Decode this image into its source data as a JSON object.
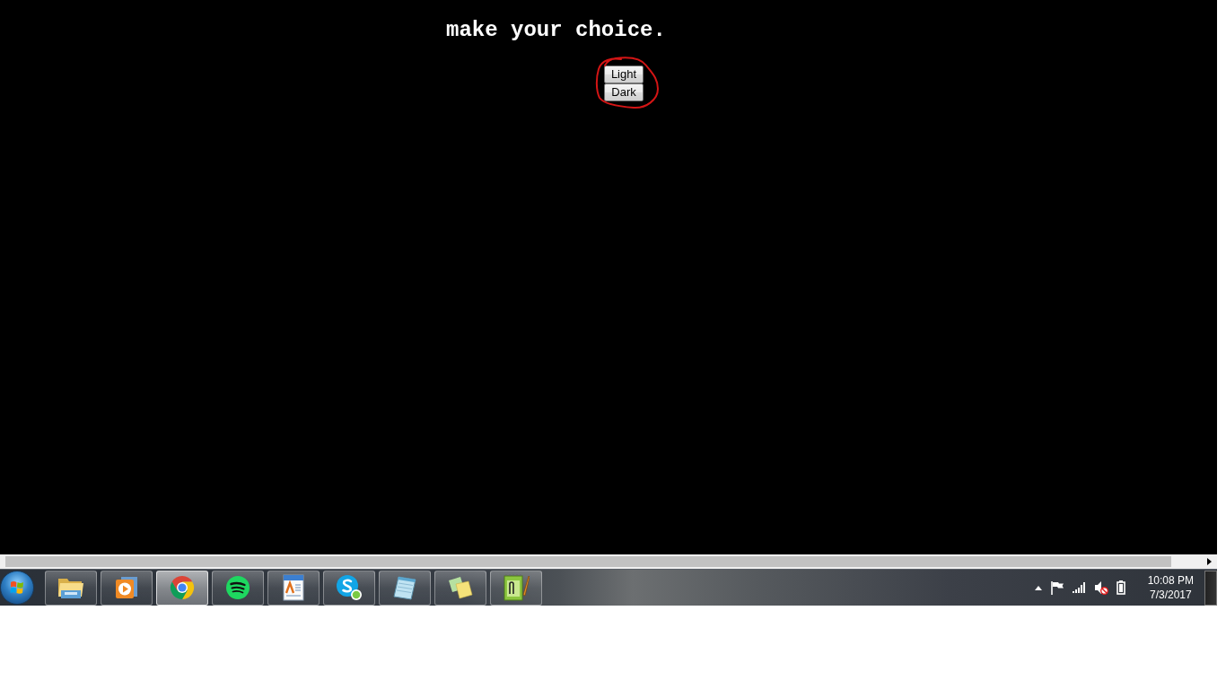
{
  "page": {
    "heading": "make your choice.",
    "buttons": [
      {
        "label": "Light"
      },
      {
        "label": "Dark"
      }
    ]
  },
  "taskbar": {
    "apps": [
      {
        "kind": "folder",
        "active": false
      },
      {
        "kind": "player",
        "active": false
      },
      {
        "kind": "browser",
        "active": true
      },
      {
        "kind": "music",
        "active": false
      },
      {
        "kind": "document",
        "active": false
      },
      {
        "kind": "chat",
        "active": false
      },
      {
        "kind": "notepad",
        "active": false
      },
      {
        "kind": "notes",
        "active": false
      },
      {
        "kind": "editor",
        "active": false
      }
    ],
    "tray": {
      "volume_muted": true
    },
    "clock": {
      "time": "10:08 PM",
      "date": "7/3/2017"
    }
  }
}
